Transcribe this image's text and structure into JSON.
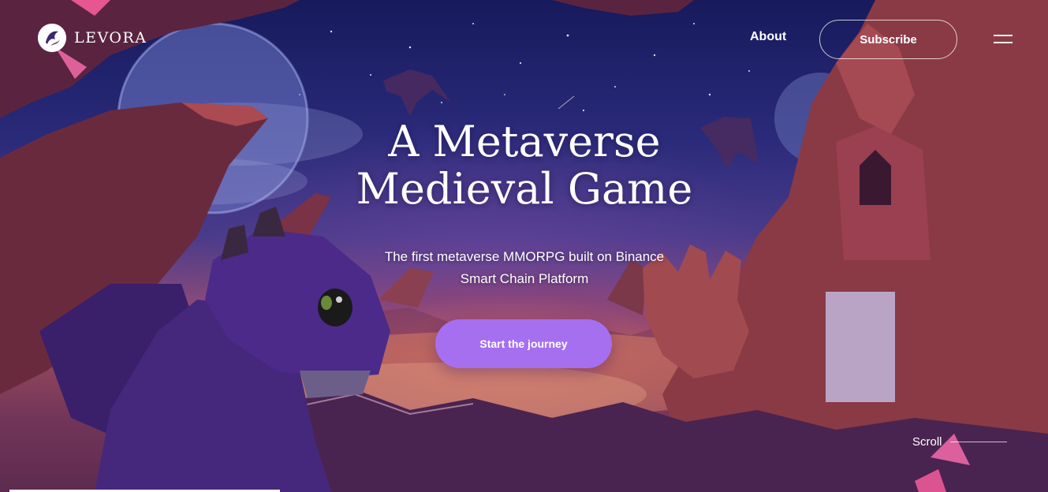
{
  "header": {
    "logo_text": "LEVORA",
    "logo_icon": "dragon-emblem-icon",
    "nav_about": "About",
    "subscribe_label": "Subscribe",
    "menu_icon": "hamburger-menu-icon"
  },
  "hero": {
    "title_line1": "A Metaverse",
    "title_line2": "Medieval Game",
    "subtitle_line1": "The first metaverse MMORPG built on Binance",
    "subtitle_line2": "Smart Chain Platform",
    "cta_label": "Start the journey"
  },
  "scroll": {
    "label": "Scroll"
  },
  "colors": {
    "accent": "#a66ff0",
    "text": "#ffffff",
    "sky_top": "#171a5c",
    "horizon_glow": "#b45a5e",
    "dragon": "#4b2a8a"
  }
}
